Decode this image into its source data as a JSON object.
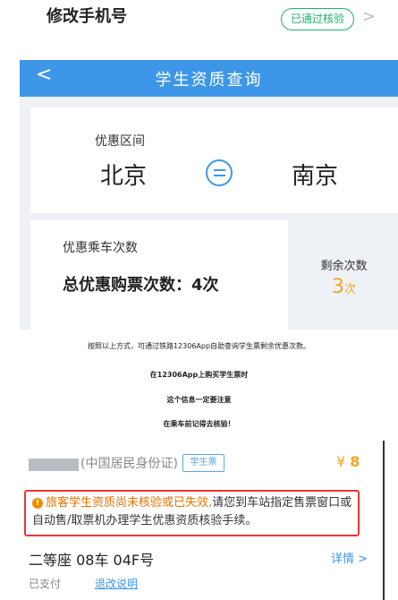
{
  "top_row": {
    "title": "修改手机号",
    "badge": "已通过核验",
    "chevron": ">"
  },
  "app_header": {
    "back": "<",
    "title": "学生资质查询"
  },
  "route": {
    "label": "优惠区间",
    "from": "北京",
    "to": "南京"
  },
  "count": {
    "label": "优惠乘车次数",
    "total": "总优惠购票次数：4次"
  },
  "remaining": {
    "label": "剩余次数",
    "value": "3",
    "unit": "次"
  },
  "captions": [
    "按照以上方式，可通过铁路12306App自助查询学生票剩余优惠次数。",
    "在12306App上购买学生票时",
    "这个信息一定要注意",
    "在乘车前记得去核验！"
  ],
  "ticket": {
    "id_type": "(中国居民身份证)",
    "tag": "学生票",
    "price_symbol": "¥",
    "price_value": "8",
    "warning_highlight": "旅客学生资质尚未核验或已失效,",
    "warning_rest": "请您到车站指定售票窗口或自动售/取票机办理学生优惠资质核验手续。",
    "seat": "二等座 08车 04F号",
    "details": "详情 >",
    "status": "已支付",
    "refund": "退改说明"
  },
  "colors": {
    "brand_blue": "#3d96e8",
    "verified_green": "#19b36b",
    "accent_orange": "#f5a623",
    "warning_red": "#e53935"
  }
}
